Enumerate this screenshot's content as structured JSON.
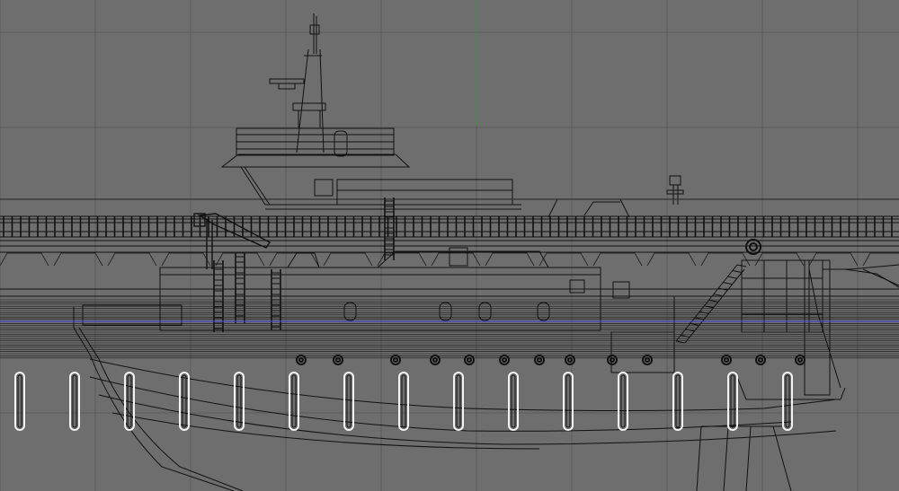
{
  "viewport": {
    "view_type": "orthographic-side",
    "shading": "wireframe",
    "colors": {
      "background": "#6e6e6e",
      "grid_minor": "#656565",
      "grid_major": "#5c5c5c",
      "wire": "#111111",
      "wire_light": "#2a2a2a",
      "y_axis": "#2f9a2f",
      "selection": "#3a3ad6",
      "highlight": "#f2f2f2"
    }
  },
  "model": {
    "name_visible": false,
    "fender_count": 15,
    "porthole_count": 13
  }
}
